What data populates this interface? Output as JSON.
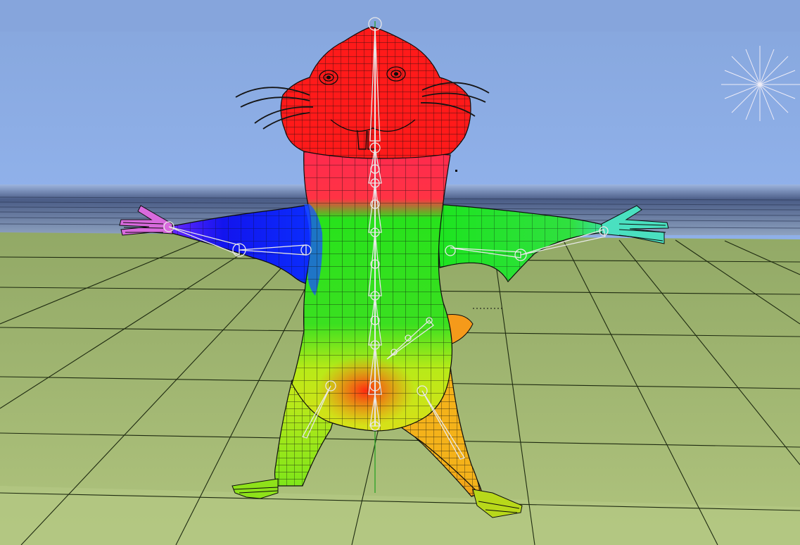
{
  "viewport": {
    "colors": {
      "sky_top": "#86a6dc",
      "sky_bottom": "#8fb0ea",
      "ground_near": "#b4c882",
      "ground_far": "#96ad68",
      "horizon_band": "#5d6f95",
      "grid_line": "#1e2a10",
      "wireframe": "#0c0c0c",
      "bones": "#e8e8e8",
      "axis_green": "#1fa01f"
    },
    "weight_map": {
      "head": "#ff1a1a",
      "neck": "#ff2a55",
      "torso": "#22e01a",
      "left_arm": "#0a10ee",
      "right_arm": "#18e024",
      "lower_torso": "#c8e81a",
      "hips": "#ff3300",
      "left_leg": "#9ae81a",
      "right_leg": "#f5b81a",
      "tail": "#f59a1a"
    },
    "icons": {
      "light": "sun-light-icon"
    }
  }
}
